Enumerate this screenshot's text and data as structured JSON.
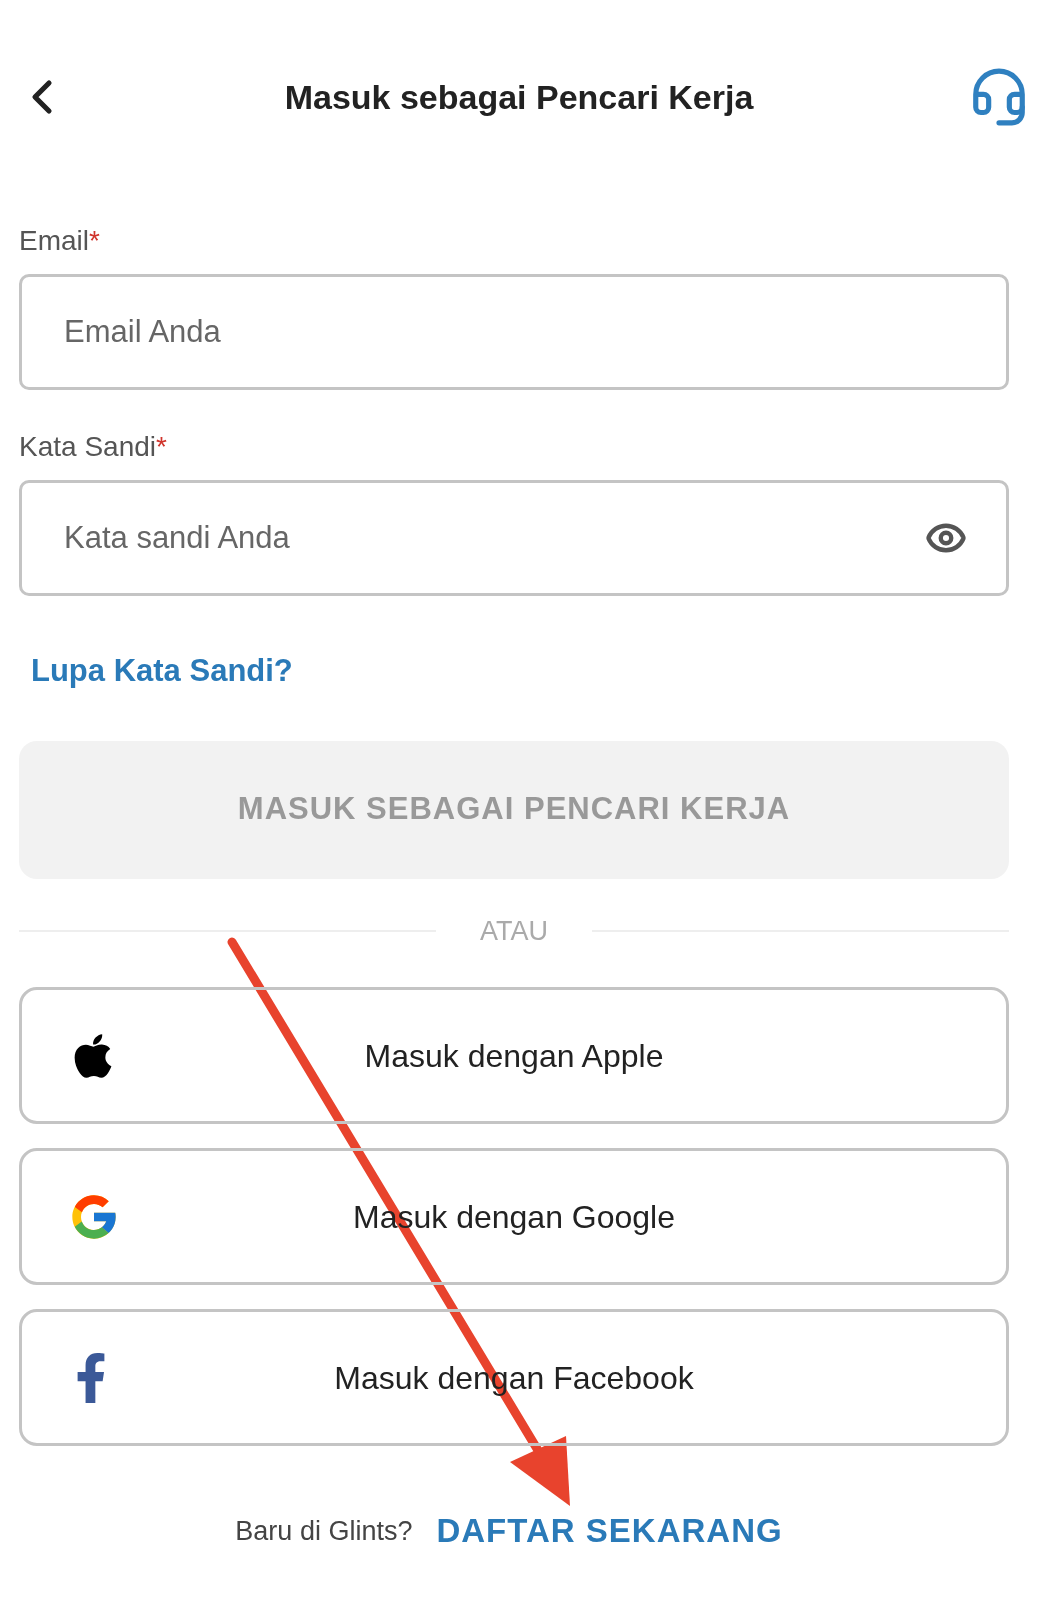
{
  "header": {
    "title": "Masuk sebagai Pencari Kerja"
  },
  "fields": [
    {
      "label": "Email",
      "required_mark": "*",
      "placeholder": "Email Anda",
      "kind": "text"
    },
    {
      "label": "Kata Sandi",
      "required_mark": "*",
      "placeholder": "Kata sandi Anda",
      "kind": "password"
    }
  ],
  "forgot_link": "Lupa Kata Sandi?",
  "login_button": {
    "label": "MASUK SEBAGAI PENCARI KERJA",
    "disabled": true
  },
  "divider": "ATAU",
  "social_buttons": [
    {
      "kind": "apple",
      "label": "Masuk dengan Apple"
    },
    {
      "kind": "google",
      "label": "Masuk dengan Google"
    },
    {
      "kind": "facebook",
      "label": "Masuk dengan Facebook"
    }
  ],
  "footer": {
    "prompt": "Baru di Glints?",
    "link": "DAFTAR SEKARANG"
  }
}
